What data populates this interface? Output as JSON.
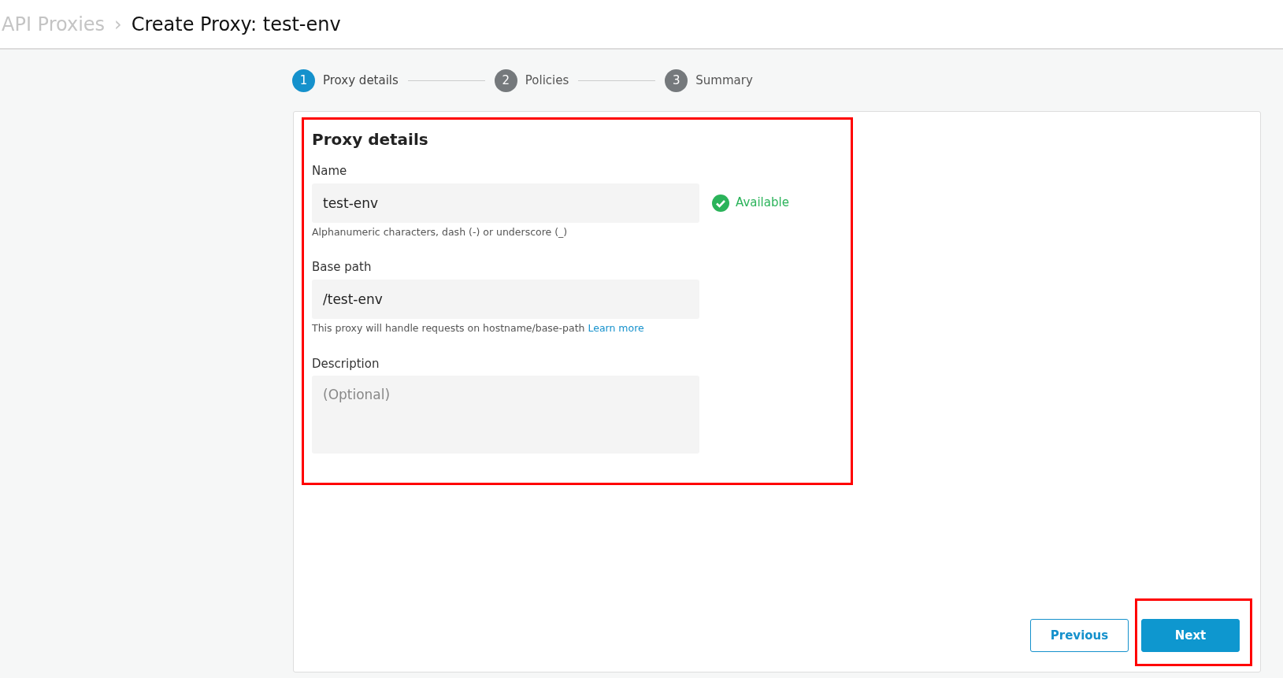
{
  "breadcrumb": {
    "parent": "API Proxies",
    "separator": "›",
    "title": "Create Proxy: test-env"
  },
  "steps": [
    {
      "number": "1",
      "label": "Proxy details",
      "selected": true
    },
    {
      "number": "2",
      "label": "Policies",
      "selected": false
    },
    {
      "number": "3",
      "label": "Summary",
      "selected": false
    }
  ],
  "form": {
    "heading": "Proxy details",
    "highlighted": true,
    "name": {
      "label": "Name",
      "value": "test-env",
      "status": "Available",
      "hint": "Alphanumeric characters, dash (-) or underscore (_)"
    },
    "base_path": {
      "label": "Base path",
      "value": "/test-env",
      "hint": "This proxy will handle requests on hostname/base-path",
      "link": "Learn more"
    },
    "description": {
      "label": "Description",
      "placeholder": "(Optional)"
    }
  },
  "buttons": [
    {
      "label": "Previous",
      "kind": "outline",
      "highlighted": false
    },
    {
      "label": "Next",
      "kind": "primary",
      "highlighted": true
    }
  ]
}
